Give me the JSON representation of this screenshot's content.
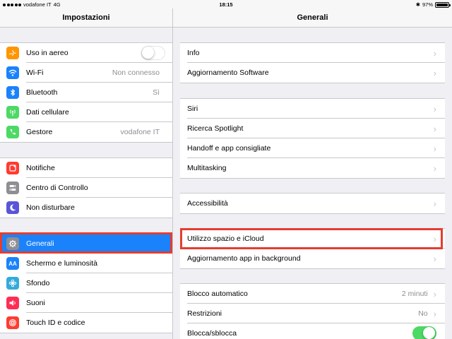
{
  "status": {
    "carrier": "vodafone IT",
    "network": "4G",
    "time": "18:15",
    "battery": "97%",
    "battery_level": 0.97
  },
  "sidebar": {
    "title": "Impostazioni",
    "groups": [
      {
        "items": [
          {
            "label": "Uso in aereo",
            "icon": "airplane-icon",
            "color": "#ff9500",
            "toggle": false
          },
          {
            "label": "Wi-Fi",
            "value": "Non connesso",
            "icon": "wifi-icon",
            "color": "#1a82fb"
          },
          {
            "label": "Bluetooth",
            "value": "Sì",
            "icon": "bluetooth-icon",
            "color": "#1a82fb"
          },
          {
            "label": "Dati cellulare",
            "icon": "antenna-icon",
            "color": "#4cd964"
          },
          {
            "label": "Gestore",
            "value": "vodafone IT",
            "icon": "phone-icon",
            "color": "#4cd964"
          }
        ]
      },
      {
        "items": [
          {
            "label": "Notifiche",
            "icon": "notifications-icon",
            "color": "#ff3b30"
          },
          {
            "label": "Centro di Controllo",
            "icon": "switches-icon",
            "color": "#8e8e93"
          },
          {
            "label": "Non disturbare",
            "icon": "moon-icon",
            "color": "#5856d6"
          }
        ]
      },
      {
        "items": [
          {
            "label": "Generali",
            "icon": "gear-icon",
            "color": "#8e8e93",
            "selected": true
          },
          {
            "label": "Schermo e luminosità",
            "icon": "text-size-icon",
            "color": "#1a82fb"
          },
          {
            "label": "Sfondo",
            "icon": "flower-icon",
            "color": "#34aadc"
          },
          {
            "label": "Suoni",
            "icon": "speaker-icon",
            "color": "#ff2d55"
          },
          {
            "label": "Touch ID e codice",
            "icon": "fingerprint-icon",
            "color": "#ff3b30"
          }
        ]
      }
    ]
  },
  "detail": {
    "title": "Generali",
    "groups": [
      {
        "items": [
          {
            "label": "Info"
          },
          {
            "label": "Aggiornamento Software"
          }
        ]
      },
      {
        "items": [
          {
            "label": "Siri"
          },
          {
            "label": "Ricerca Spotlight"
          },
          {
            "label": "Handoff e app consigliate"
          },
          {
            "label": "Multitasking"
          }
        ]
      },
      {
        "items": [
          {
            "label": "Accessibilità"
          }
        ]
      },
      {
        "items": [
          {
            "label": "Utilizzo spazio e iCloud"
          },
          {
            "label": "Aggiornamento app in background"
          }
        ]
      },
      {
        "items": [
          {
            "label": "Blocco automatico",
            "value": "2 minuti"
          },
          {
            "label": "Restrizioni",
            "value": "No"
          },
          {
            "label": "Blocca/sblocca",
            "toggle": true
          }
        ]
      }
    ]
  },
  "colors": {
    "highlight": "#e43d30",
    "selected": "#1a82fb",
    "toggle_on": "#4cd964"
  }
}
